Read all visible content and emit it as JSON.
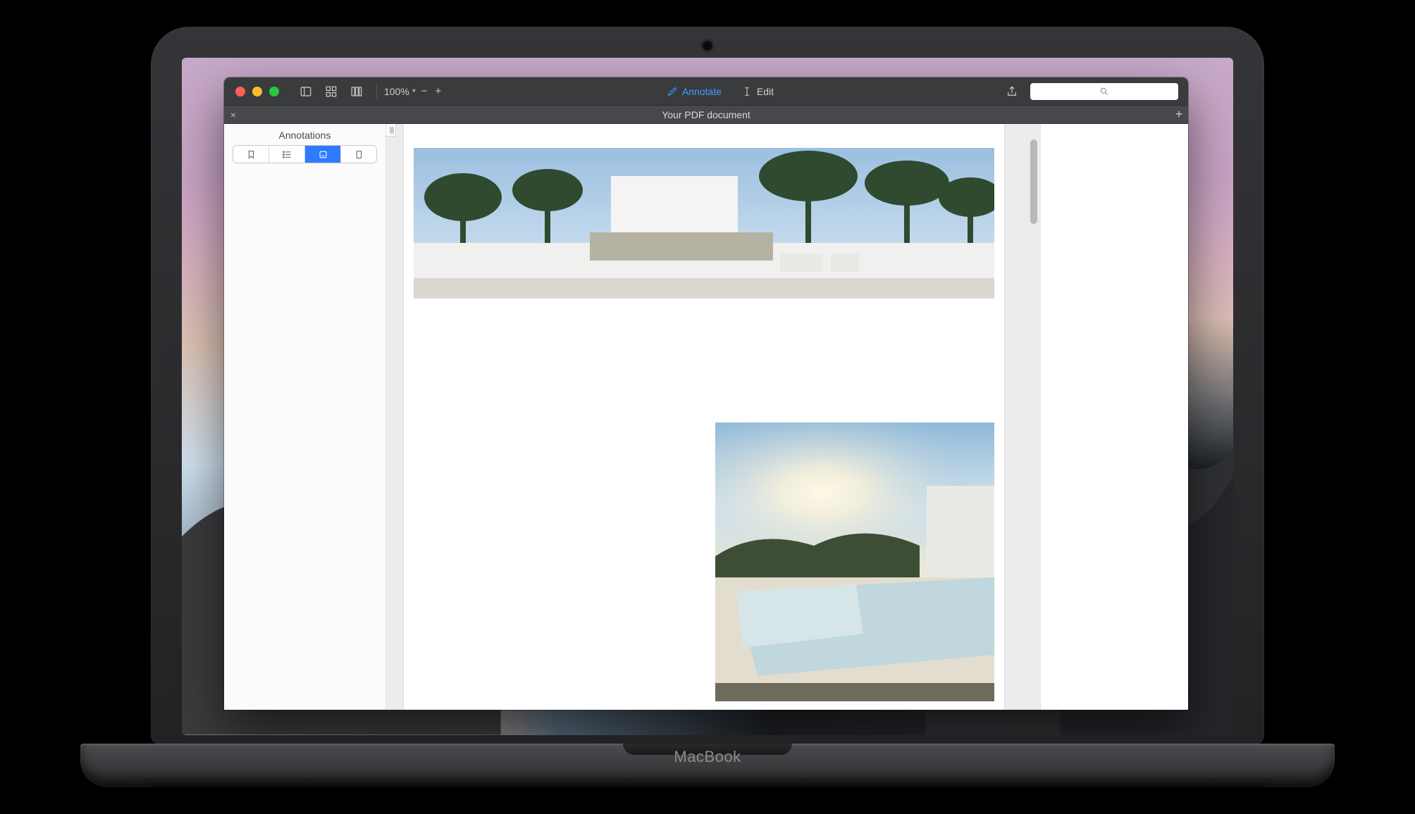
{
  "device": {
    "brand": "MacBook"
  },
  "toolbar": {
    "zoom_label": "100%",
    "annotate_label": "Annotate",
    "edit_label": "Edit"
  },
  "tabs": {
    "document_title": "Your PDF document"
  },
  "sidebar": {
    "panel_title": "Annotations",
    "segments": [
      "bookmarks",
      "outline",
      "annotations",
      "thumbnails"
    ]
  },
  "search": {
    "placeholder": ""
  },
  "icons": {
    "close": "close-icon",
    "minimize": "minimize-icon",
    "zoom": "zoom-icon",
    "sidebar": "sidebar-toggle-icon",
    "thumbnails": "thumbnails-icon",
    "contact_sheet": "contact-sheet-icon",
    "chevron": "chevron-down-icon",
    "zoom_out": "minus-icon",
    "zoom_in": "plus-icon",
    "annotate": "pencil-icon",
    "edit": "text-cursor-icon",
    "share": "share-icon",
    "search": "search-icon",
    "tab_close": "close-icon",
    "tab_add": "plus-icon",
    "seg_bookmark": "bookmark-icon",
    "seg_outline": "list-icon",
    "seg_annotations": "annotation-icon",
    "seg_thumbnail": "page-icon"
  }
}
